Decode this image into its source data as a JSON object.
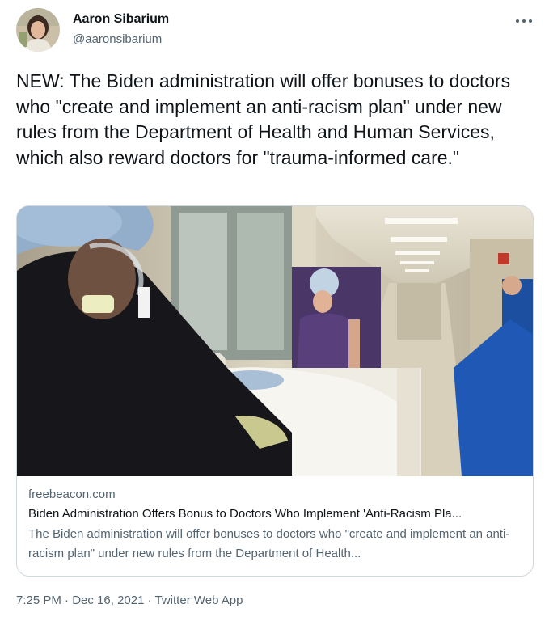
{
  "author": {
    "display_name": "Aaron Sibarium",
    "handle": "@aaronsibarium",
    "avatar_icon": "profile-photo"
  },
  "menu": {
    "icon": "more-horizontal-icon"
  },
  "tweet": {
    "text": "NEW: The Biden administration will offer bonuses to doctors who \"create and implement an anti-racism plan\" under new rules from the Department of Health and Human Services, which also reward doctors for \"trauma-informed care.\""
  },
  "card": {
    "image_icon": "hospital-hallway-photo",
    "domain": "freebeacon.com",
    "title": "Biden Administration Offers Bonus to Doctors Who Implement 'Anti-Racism Pla...",
    "description": "The Biden administration will offer bonuses to doctors who \"create and implement an anti-racism plan\" under new rules from the Department of Health..."
  },
  "meta": {
    "time": "7:25 PM",
    "separator": " · ",
    "date": "Dec 16, 2021",
    "source": "Twitter Web App"
  },
  "colors": {
    "text_primary": "#0f1419",
    "text_secondary": "#536471",
    "border": "#cfd9de"
  }
}
